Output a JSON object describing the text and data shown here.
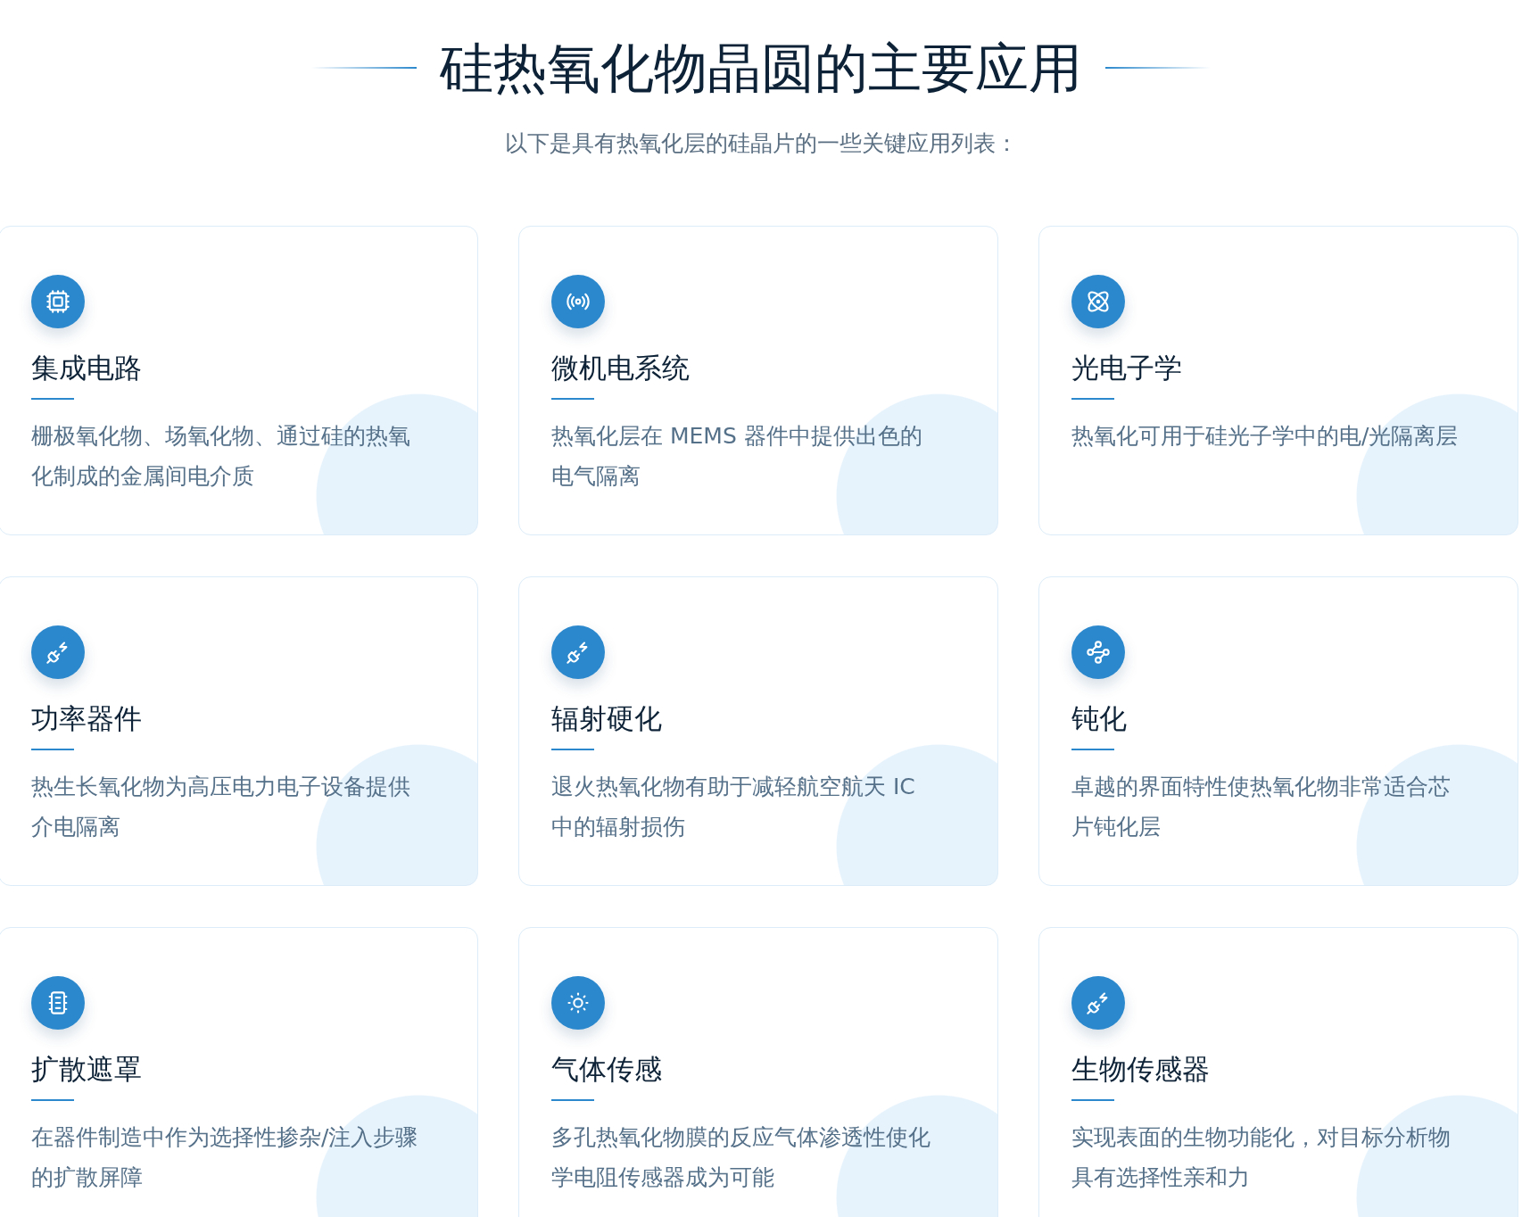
{
  "header": {
    "title": "硅热氧化物晶圆的主要应用",
    "subtitle": "以下是具有热氧化层的硅晶片的一些关键应用列表："
  },
  "cards": [
    {
      "title": "集成电路",
      "description": "栅极氧化物、场氧化物、通过硅的热氧化制成的金属间电介质"
    },
    {
      "title": "微机电系统",
      "description": "热氧化层在 MEMS 器件中提供出色的电气隔离"
    },
    {
      "title": "光电子学",
      "description": "热氧化可用于硅光子学中的电/光隔离层"
    },
    {
      "title": "功率器件",
      "description": "热生长氧化物为高压电力电子设备提供介电隔离"
    },
    {
      "title": "辐射硬化",
      "description": "退火热氧化物有助于减轻航空航天 IC 中的辐射损伤"
    },
    {
      "title": "钝化",
      "description": "卓越的界面特性使热氧化物非常适合芯片钝化层"
    },
    {
      "title": "扩散遮罩",
      "description": "在器件制造中作为选择性掺杂/注入步骤的扩散屏障"
    },
    {
      "title": "气体传感",
      "description": "多孔热氧化物膜的反应气体渗透性使化学电阻传感器成为可能"
    },
    {
      "title": "生物传感器",
      "description": "实现表面的生物功能化，对目标分析物具有选择性亲和力"
    }
  ]
}
